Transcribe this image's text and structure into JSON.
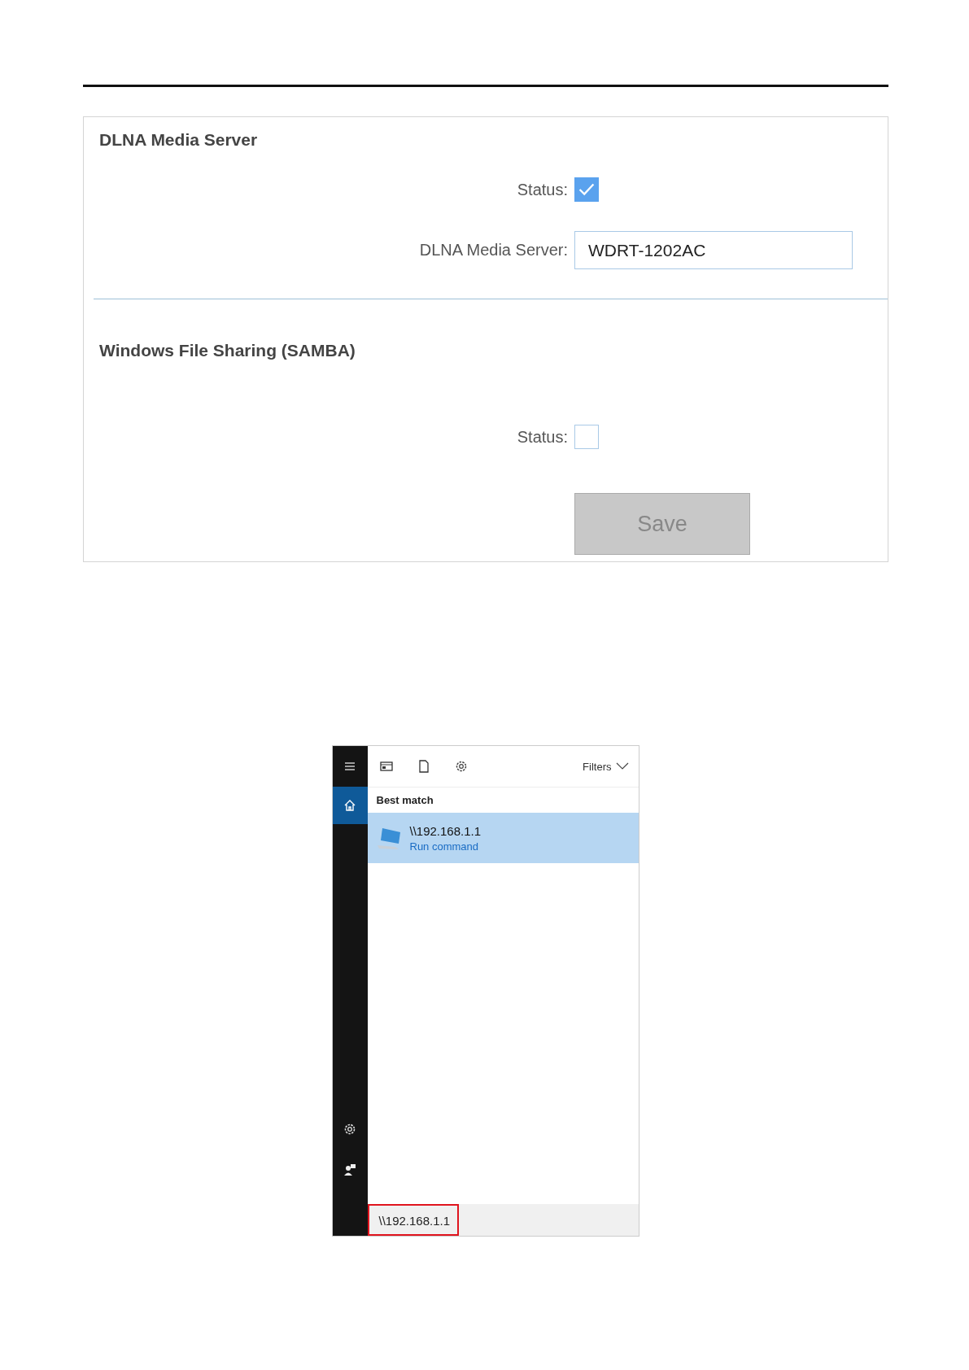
{
  "settings": {
    "sections": [
      {
        "title": "DLNA Media Server",
        "fields": [
          {
            "kind": "checkbox",
            "label": "Status:",
            "checked": true
          },
          {
            "kind": "text",
            "label": "DLNA Media Server:",
            "value": "WDRT-1202AC"
          }
        ]
      },
      {
        "title": "Windows File Sharing (SAMBA)",
        "fields": [
          {
            "kind": "checkbox",
            "label": "Status:",
            "checked": false
          }
        ]
      }
    ],
    "save_button": "Save"
  },
  "search_panel": {
    "sidebar": [
      {
        "kind": "menu",
        "selected": false
      },
      {
        "kind": "home",
        "selected": true
      },
      {
        "kind": "settings",
        "selected": false
      },
      {
        "kind": "feedback",
        "selected": false
      }
    ],
    "toolbar": [
      {
        "kind": "apps"
      },
      {
        "kind": "documents"
      },
      {
        "kind": "settings"
      }
    ],
    "filters": "Filters",
    "best_match_heading": "Best match",
    "results": [
      {
        "title": "\\\\192.168.1.1",
        "subtitle": "Run command",
        "selected": true
      }
    ],
    "search_box": {
      "value": "\\\\192.168.1.1",
      "highlighted": true
    }
  }
}
